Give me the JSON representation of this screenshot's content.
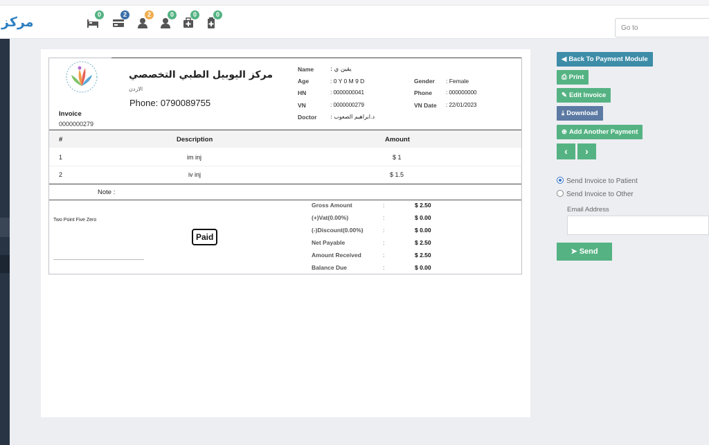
{
  "brand": {
    "name": "مركز"
  },
  "toolbar": {
    "icons": [
      {
        "name": "bed-icon",
        "badge": "0",
        "badge_color": "#55b383"
      },
      {
        "name": "card-icon",
        "badge": "2",
        "badge_color": "#3b6fa8"
      },
      {
        "name": "user-icon",
        "badge": "2",
        "badge_color": "#f0ad4e"
      },
      {
        "name": "user-icon",
        "badge": "0",
        "badge_color": "#55b383"
      },
      {
        "name": "medkit-icon",
        "badge": "0",
        "badge_color": "#55b383"
      },
      {
        "name": "clipboard-icon",
        "badge": "0",
        "badge_color": "#55b383"
      }
    ],
    "goto_placeholder": "Go to"
  },
  "invoice": {
    "hospital_name": "مركز اليوبيل الطبي التخصصي",
    "hospital_sub": "الاردن",
    "phone": "Phone: 0790089755",
    "label": "Invoice",
    "number": "0000000279",
    "patient": {
      "name_label": "Name",
      "name_value": ": يقين ي",
      "age_label": "Age",
      "age_value": ": 0 Y 0 M 9 D",
      "hn_label": "HN",
      "hn_value": ": 0000000041",
      "vn_label": "VN",
      "vn_value": ": 0000000279",
      "doctor_label": "Doctor",
      "doctor_value": ": د.ابراهيم الصعوب",
      "gender_label": "Gender",
      "gender_value": ": Female",
      "phone_label": "Phone",
      "phone_value": ": 000000000",
      "vndate_label": "VN Date",
      "vndate_value": ": 22/01/2023"
    },
    "table": {
      "headers": [
        "#",
        "Description",
        "Amount"
      ],
      "rows": [
        {
          "no": "1",
          "desc": "im inj",
          "amount": "$ 1"
        },
        {
          "no": "2",
          "desc": "iv inj",
          "amount": "$ 1.5"
        }
      ]
    },
    "note_label": "Note :",
    "amount_words": "Two Point Five Zero",
    "paid_stamp": "Paid",
    "totals": [
      {
        "label": "Gross Amount",
        "sep": ":",
        "value": "$ 2.50"
      },
      {
        "label": "(+)Vat(0.00%)",
        "sep": ":",
        "value": "$ 0.00"
      },
      {
        "label": "(-)Discount(0.00%)",
        "sep": ":",
        "value": "$ 0.00"
      },
      {
        "label": "Net Payable",
        "sep": ":",
        "value": "$ 2.50"
      },
      {
        "label": "Amount Received",
        "sep": ":",
        "value": "$ 2.50"
      },
      {
        "label": "Balance Due",
        "sep": ":",
        "value": "$ 0.00"
      }
    ]
  },
  "actions": {
    "back_label": "Back To Payment Module",
    "print_label": "Print",
    "edit_label": "Edit Invoice",
    "download_label": "Download",
    "add_payment_label": "Add Another Payment",
    "prev_glyph": "‹",
    "next_glyph": "›"
  },
  "send": {
    "option_patient": "Send Invoice to Patient",
    "option_other": "Send Invoice to Other",
    "selected": "patient",
    "email_label": "Email Address",
    "email_value": "",
    "send_label": "Send"
  }
}
